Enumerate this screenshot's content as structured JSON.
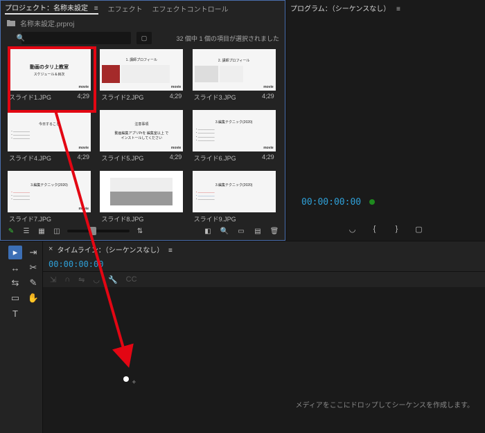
{
  "colors": {
    "accent": "#2fa0d8",
    "highlight": "#e30613",
    "green": "#1e8a1e"
  },
  "project_panel": {
    "tabs": {
      "project": "プロジェクト：名称未設定",
      "effects": "エフェクト",
      "effect_controls": "エフェクトコントロール"
    },
    "path": "名称未設定.prproj",
    "search_placeholder": "",
    "selection_status": "32 個中 1 個の項目が選択されました",
    "clips": [
      {
        "name": "スライド1.JPG",
        "duration": "4;29",
        "title": "動画のタリ上教室",
        "sub": "スケジュール＆目次"
      },
      {
        "name": "スライド2.JPG",
        "duration": "4;29",
        "title": "1. 講師プロフィール",
        "sub": ""
      },
      {
        "name": "スライド3.JPG",
        "duration": "4;29",
        "title": "2. 講師プロフィール",
        "sub": ""
      },
      {
        "name": "スライド4.JPG",
        "duration": "4;29",
        "title": "今日すること",
        "sub": ""
      },
      {
        "name": "スライド5.JPG",
        "duration": "4;29",
        "title": "注意事項",
        "sub": "動画編集アプリPrを 編集室以上 で\nインストールしてください"
      },
      {
        "name": "スライド6.JPG",
        "duration": "4;29",
        "title": "3.編集テクニック(2020)",
        "sub": ""
      },
      {
        "name": "スライド7.JPG",
        "duration": "",
        "title": "3.編集テクニック(2020)",
        "sub": ""
      },
      {
        "name": "スライド8.JPG",
        "duration": "",
        "title": "",
        "sub": ""
      },
      {
        "name": "スライド9.JPG",
        "duration": "",
        "title": "3.編集テクニック(2020)",
        "sub": ""
      }
    ],
    "footer_icons": {
      "pencil": "pencil-icon",
      "list": "list-view-icon",
      "icon_view": "icon-view-icon",
      "freeform": "freeform-view-icon",
      "sort": "sort-icon",
      "auto_seq": "automate-to-sequence-icon",
      "find": "find-icon",
      "new_bin": "new-bin-icon",
      "new_item": "new-item-icon",
      "trash": "trash-icon"
    }
  },
  "program_panel": {
    "title": "プログラム：（シーケンスなし）",
    "timecode": "00:00:00:00"
  },
  "timeline_panel": {
    "title": "タイムライン：（シーケンスなし）",
    "timecode": "00:00:00:00",
    "drop_hint": "メディアをここにドロップしてシーケンスを作成します。"
  },
  "tools": [
    "selection",
    "track-select",
    "ripple",
    "rolling",
    "rate",
    "razor",
    "slip",
    "hand",
    "pen",
    "type"
  ]
}
